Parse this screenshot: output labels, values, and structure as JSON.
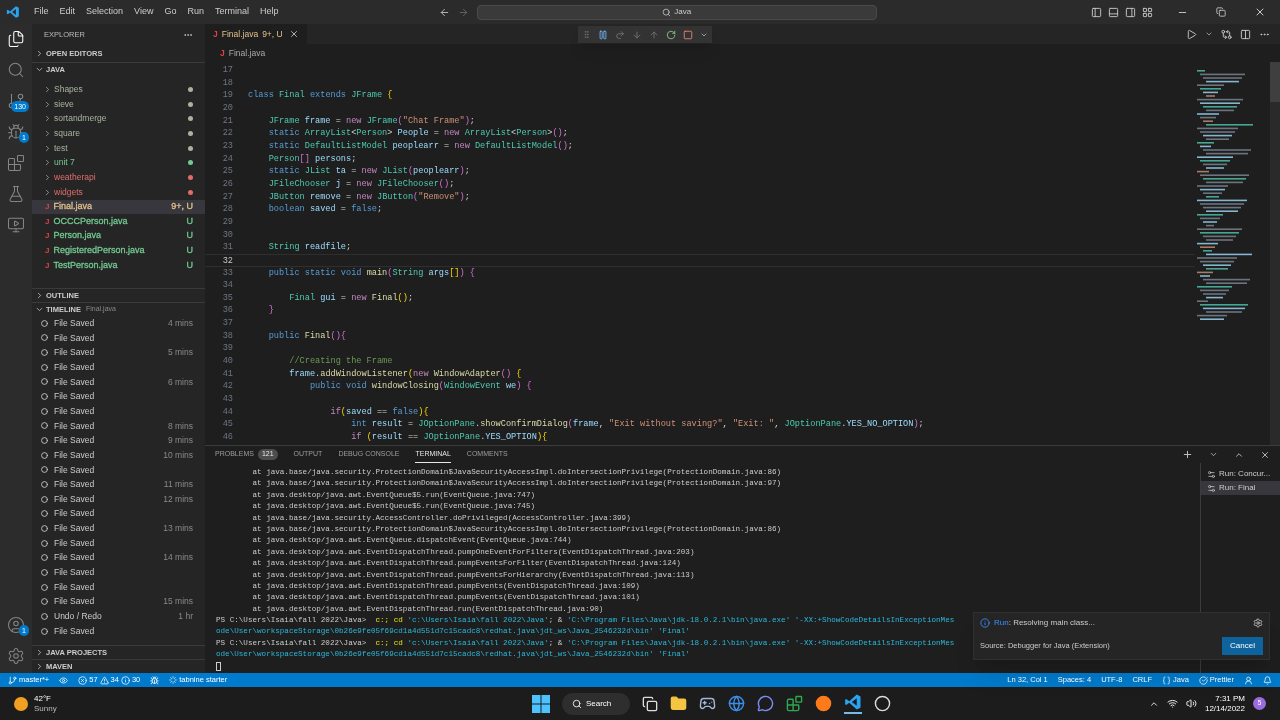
{
  "title_bar": {
    "menus": [
      "File",
      "Edit",
      "Selection",
      "View",
      "Go",
      "Run",
      "Terminal",
      "Help"
    ],
    "search": "Java"
  },
  "activity_bar": {
    "items": [
      {
        "kind": "explorer",
        "selected": true
      },
      {
        "kind": "search",
        "selected": false
      },
      {
        "kind": "scm",
        "badge": "130",
        "selected": false
      },
      {
        "kind": "debug",
        "badge": "1",
        "selected": false
      },
      {
        "kind": "extensions",
        "selected": false
      },
      {
        "kind": "testing",
        "selected": false
      },
      {
        "kind": "remote",
        "selected": false
      }
    ],
    "account_badge": "1"
  },
  "sidebar": {
    "title": "EXPLORER",
    "open_editors": "OPEN EDITORS",
    "folder": "JAVA",
    "items": [
      {
        "kind": "folder",
        "name": "Shapes",
        "color": "#a8b4a0",
        "selected": false
      },
      {
        "kind": "folder",
        "name": "sieve",
        "color": "#a8b4a0",
        "selected": false
      },
      {
        "kind": "folder",
        "name": "sortandmerge",
        "color": "#a8b4a0",
        "selected": false
      },
      {
        "kind": "folder",
        "name": "square",
        "color": "#a8b4a0",
        "selected": false
      },
      {
        "kind": "folder",
        "name": "test",
        "color": "#a8b4a0",
        "selected": false
      },
      {
        "kind": "folder",
        "name": "unit 7",
        "color": "#73c991",
        "selected": false
      },
      {
        "kind": "folder",
        "name": "weatherapi",
        "color": "#e06c6c",
        "selected": false
      },
      {
        "kind": "folder",
        "name": "widgets",
        "color": "#e06c6c",
        "selected": false
      },
      {
        "kind": "file",
        "icon": "J",
        "name": "Final.java",
        "decoration": "9+, U",
        "color": "#e2c08d",
        "selected": true
      },
      {
        "kind": "file",
        "icon": "J",
        "name": "OCCCPerson.java",
        "decoration": "U",
        "color": "#73c991",
        "selected": false
      },
      {
        "kind": "file",
        "icon": "J",
        "name": "Person.java",
        "decoration": "U",
        "color": "#73c991",
        "selected": false
      },
      {
        "kind": "file",
        "icon": "J",
        "name": "RegisteredPerson.java",
        "decoration": "U",
        "color": "#73c991",
        "selected": false
      },
      {
        "kind": "file",
        "icon": "J",
        "name": "TestPerson.java",
        "decoration": "U",
        "color": "#73c991",
        "selected": false
      }
    ],
    "outline": "OUTLINE",
    "timeline": {
      "label": "TIMELINE",
      "file": "Final.java",
      "items": [
        {
          "label": "File Saved",
          "time": "4 mins"
        },
        {
          "label": "File Saved"
        },
        {
          "label": "File Saved",
          "time": "5 mins"
        },
        {
          "label": "File Saved"
        },
        {
          "label": "File Saved",
          "time": "6 mins"
        },
        {
          "label": "File Saved"
        },
        {
          "label": "File Saved"
        },
        {
          "label": "File Saved",
          "time": "8 mins"
        },
        {
          "label": "File Saved",
          "time": "9 mins"
        },
        {
          "label": "File Saved",
          "time": "10 mins"
        },
        {
          "label": "File Saved"
        },
        {
          "label": "File Saved",
          "time": "11 mins"
        },
        {
          "label": "File Saved",
          "time": "12 mins"
        },
        {
          "label": "File Saved"
        },
        {
          "label": "File Saved",
          "time": "13 mins"
        },
        {
          "label": "File Saved"
        },
        {
          "label": "File Saved",
          "time": "14 mins"
        },
        {
          "label": "File Saved"
        },
        {
          "label": "File Saved"
        },
        {
          "label": "File Saved",
          "time": "15 mins"
        },
        {
          "label": "Undo / Redo",
          "time": "1 hr"
        },
        {
          "label": "File Saved"
        }
      ]
    },
    "bottom_sections": [
      "JAVA PROJECTS",
      "MAVEN"
    ]
  },
  "editor": {
    "tab": {
      "icon": "J",
      "label": "Final.java",
      "badge": "9+, U"
    },
    "breadcrumb": {
      "icon": "J",
      "label": "Final.java"
    },
    "lines": [
      {
        "n": "17",
        "current": false
      },
      {
        "n": "18",
        "current": false
      },
      {
        "n": "19",
        "current": false,
        "segs": [
          {
            "kind": "kw",
            "text": "class"
          },
          {
            "kind": "type",
            "text": " Final"
          },
          {
            "kind": "kw",
            "text": " extends"
          },
          {
            "kind": "type",
            "text": " JFrame"
          },
          {
            "kind": "br",
            "text": " {"
          }
        ]
      },
      {
        "n": "20",
        "current": false
      },
      {
        "n": "21",
        "current": false,
        "segs": [
          {
            "kind": "type",
            "text": "    JFrame"
          },
          {
            "kind": "var",
            "text": " frame"
          },
          {
            "kind": "pl",
            "text": " = "
          },
          {
            "kind": "ctl",
            "text": "new"
          },
          {
            "kind": "type",
            "text": " JFrame"
          },
          {
            "kind": "br2",
            "text": "("
          },
          {
            "kind": "str",
            "text": "\"Chat Frame\""
          },
          {
            "kind": "br2",
            "text": ")"
          },
          {
            "kind": "pl",
            "text": ";"
          }
        ]
      },
      {
        "n": "22",
        "current": false,
        "segs": [
          {
            "kind": "kw",
            "text": "    static"
          },
          {
            "kind": "type",
            "text": " ArrayList"
          },
          {
            "kind": "pl",
            "text": "<"
          },
          {
            "kind": "type",
            "text": "Person"
          },
          {
            "kind": "pl",
            "text": "> "
          },
          {
            "kind": "var",
            "text": "People"
          },
          {
            "kind": "pl",
            "text": " = "
          },
          {
            "kind": "ctl",
            "text": "new"
          },
          {
            "kind": "type",
            "text": " ArrayList"
          },
          {
            "kind": "pl",
            "text": "<"
          },
          {
            "kind": "type",
            "text": "Person"
          },
          {
            "kind": "pl",
            "text": ">"
          },
          {
            "kind": "br2",
            "text": "()"
          },
          {
            "kind": "pl",
            "text": ";"
          }
        ]
      },
      {
        "n": "23",
        "current": false,
        "segs": [
          {
            "kind": "kw",
            "text": "    static"
          },
          {
            "kind": "type",
            "text": " DefaultListModel"
          },
          {
            "kind": "var",
            "text": " peoplearr"
          },
          {
            "kind": "pl",
            "text": " = "
          },
          {
            "kind": "ctl",
            "text": "new"
          },
          {
            "kind": "type",
            "text": " DefaultListModel"
          },
          {
            "kind": "br2",
            "text": "()"
          },
          {
            "kind": "pl",
            "text": ";"
          }
        ]
      },
      {
        "n": "24",
        "current": false,
        "segs": [
          {
            "kind": "type",
            "text": "    Person"
          },
          {
            "kind": "br2",
            "text": "[]"
          },
          {
            "kind": "var",
            "text": " persons"
          },
          {
            "kind": "pl",
            "text": ";"
          }
        ]
      },
      {
        "n": "25",
        "current": false,
        "segs": [
          {
            "kind": "kw",
            "text": "    static"
          },
          {
            "kind": "type",
            "text": " JList"
          },
          {
            "kind": "var",
            "text": " ta"
          },
          {
            "kind": "pl",
            "text": " = "
          },
          {
            "kind": "ctl",
            "text": "new"
          },
          {
            "kind": "type",
            "text": " JList"
          },
          {
            "kind": "br2",
            "text": "("
          },
          {
            "kind": "var",
            "text": "peoplearr"
          },
          {
            "kind": "br2",
            "text": ")"
          },
          {
            "kind": "pl",
            "text": ";"
          }
        ]
      },
      {
        "n": "26",
        "current": false,
        "segs": [
          {
            "kind": "type",
            "text": "    JFileChooser"
          },
          {
            "kind": "var",
            "text": " j"
          },
          {
            "kind": "pl",
            "text": " = "
          },
          {
            "kind": "ctl",
            "text": "new"
          },
          {
            "kind": "type",
            "text": " JFileChooser"
          },
          {
            "kind": "br2",
            "text": "()"
          },
          {
            "kind": "pl",
            "text": ";"
          }
        ]
      },
      {
        "n": "27",
        "current": false,
        "segs": [
          {
            "kind": "type",
            "text": "    JButton"
          },
          {
            "kind": "var",
            "text": " remove"
          },
          {
            "kind": "pl",
            "text": " = "
          },
          {
            "kind": "ctl",
            "text": "new"
          },
          {
            "kind": "type",
            "text": " JButton"
          },
          {
            "kind": "br2",
            "text": "("
          },
          {
            "kind": "str",
            "text": "\"Remove\""
          },
          {
            "kind": "br2",
            "text": ")"
          },
          {
            "kind": "pl",
            "text": ";"
          }
        ]
      },
      {
        "n": "28",
        "current": false,
        "segs": [
          {
            "kind": "kw",
            "text": "    boolean"
          },
          {
            "kind": "var",
            "text": " saved"
          },
          {
            "kind": "pl",
            "text": " = "
          },
          {
            "kind": "kw",
            "text": "false"
          },
          {
            "kind": "pl",
            "text": ";"
          }
        ]
      },
      {
        "n": "29",
        "current": false
      },
      {
        "n": "30",
        "current": false
      },
      {
        "n": "31",
        "current": false,
        "segs": [
          {
            "kind": "type",
            "text": "    String"
          },
          {
            "kind": "var",
            "text": " readfile"
          },
          {
            "kind": "pl",
            "text": ";"
          }
        ]
      },
      {
        "n": "32",
        "current": true
      },
      {
        "n": "33",
        "current": false,
        "segs": [
          {
            "kind": "kw",
            "text": "    public static void"
          },
          {
            "kind": "fn",
            "text": " main"
          },
          {
            "kind": "br2",
            "text": "("
          },
          {
            "kind": "type",
            "text": "String"
          },
          {
            "kind": "var",
            "text": " args"
          },
          {
            "kind": "br",
            "text": "[]"
          },
          {
            "kind": "br2",
            "text": ")"
          },
          {
            "kind": "br2",
            "text": " {"
          }
        ]
      },
      {
        "n": "34",
        "current": false
      },
      {
        "n": "35",
        "current": false,
        "segs": [
          {
            "kind": "type",
            "text": "        Final"
          },
          {
            "kind": "var",
            "text": " gui"
          },
          {
            "kind": "pl",
            "text": " = "
          },
          {
            "kind": "ctl",
            "text": "new"
          },
          {
            "kind": "fn",
            "text": " Final"
          },
          {
            "kind": "br",
            "text": "()"
          },
          {
            "kind": "pl",
            "text": ";"
          }
        ]
      },
      {
        "n": "36",
        "current": false,
        "segs": [
          {
            "kind": "br2",
            "text": "    }"
          }
        ]
      },
      {
        "n": "37",
        "current": false
      },
      {
        "n": "38",
        "current": false,
        "segs": [
          {
            "kind": "kw",
            "text": "    public"
          },
          {
            "kind": "fn",
            "text": " Final"
          },
          {
            "kind": "br2",
            "text": "(){"
          }
        ]
      },
      {
        "n": "39",
        "current": false
      },
      {
        "n": "40",
        "current": false,
        "segs": [
          {
            "kind": "cmt",
            "text": "        //Creating the Frame"
          }
        ]
      },
      {
        "n": "41",
        "current": false,
        "segs": [
          {
            "kind": "var",
            "text": "        frame"
          },
          {
            "kind": "pl",
            "text": "."
          },
          {
            "kind": "fn",
            "text": "addWindowListener"
          },
          {
            "kind": "br",
            "text": "("
          },
          {
            "kind": "ctl",
            "text": "new"
          },
          {
            "kind": "fn",
            "text": " WindowAdapter"
          },
          {
            "kind": "br2",
            "text": "()"
          },
          {
            "kind": "br",
            "text": " {"
          }
        ]
      },
      {
        "n": "42",
        "current": false,
        "segs": [
          {
            "kind": "kw",
            "text": "            public void"
          },
          {
            "kind": "fn",
            "text": " windowClosing"
          },
          {
            "kind": "br2",
            "text": "("
          },
          {
            "kind": "type",
            "text": "WindowEvent"
          },
          {
            "kind": "var",
            "text": " we"
          },
          {
            "kind": "br2",
            "text": ")"
          },
          {
            "kind": "br2",
            "text": " {"
          }
        ]
      },
      {
        "n": "43",
        "current": false
      },
      {
        "n": "44",
        "current": false,
        "segs": [
          {
            "kind": "ctl",
            "text": "                if"
          },
          {
            "kind": "br",
            "text": "("
          },
          {
            "kind": "var",
            "text": "saved"
          },
          {
            "kind": "pl",
            "text": " == "
          },
          {
            "kind": "kw",
            "text": "false"
          },
          {
            "kind": "br",
            "text": "){"
          }
        ]
      },
      {
        "n": "45",
        "current": false,
        "segs": [
          {
            "kind": "kw",
            "text": "                    int"
          },
          {
            "kind": "var",
            "text": " result"
          },
          {
            "kind": "pl",
            "text": " = "
          },
          {
            "kind": "type",
            "text": "JOptionPane"
          },
          {
            "kind": "pl",
            "text": "."
          },
          {
            "kind": "fn",
            "text": "showConfirmDialog"
          },
          {
            "kind": "br2",
            "text": "("
          },
          {
            "kind": "var",
            "text": "frame"
          },
          {
            "kind": "pl",
            "text": ", "
          },
          {
            "kind": "str",
            "text": "\"Exit without saving?\""
          },
          {
            "kind": "pl",
            "text": ", "
          },
          {
            "kind": "str",
            "text": "\"Exit: \""
          },
          {
            "kind": "pl",
            "text": ", "
          },
          {
            "kind": "type",
            "text": "JOptionPane"
          },
          {
            "kind": "pl",
            "text": "."
          },
          {
            "kind": "var",
            "text": "YES_NO_OPTION"
          },
          {
            "kind": "br2",
            "text": ")"
          },
          {
            "kind": "pl",
            "text": ";"
          }
        ]
      },
      {
        "n": "46",
        "current": false,
        "segs": [
          {
            "kind": "ctl",
            "text": "                    if"
          },
          {
            "kind": "br",
            "text": " ("
          },
          {
            "kind": "var",
            "text": "result"
          },
          {
            "kind": "pl",
            "text": " == "
          },
          {
            "kind": "type",
            "text": "JOptionPane"
          },
          {
            "kind": "pl",
            "text": "."
          },
          {
            "kind": "var",
            "text": "YES_OPTION"
          },
          {
            "kind": "br",
            "text": "){"
          }
        ]
      }
    ]
  },
  "panel": {
    "tabs": [
      {
        "label": "PROBLEMS",
        "badge": "121",
        "selected": false
      },
      {
        "label": "OUTPUT",
        "selected": false
      },
      {
        "label": "DEBUG CONSOLE",
        "selected": false
      },
      {
        "label": "TERMINAL",
        "selected": true
      },
      {
        "label": "COMMENTS",
        "selected": false
      }
    ],
    "terminal_lines": [
      {
        "kind": "text",
        "segs": [
          {
            "kind": "pl",
            "text": "        at java.base/java.security.ProtectionDomain$JavaSecurityAccessImpl.doIntersectionPrivilege(ProtectionDomain.java:86)"
          }
        ]
      },
      {
        "kind": "text",
        "segs": [
          {
            "kind": "pl",
            "text": "        at java.base/java.security.ProtectionDomain$JavaSecurityAccessImpl.doIntersectionPrivilege(ProtectionDomain.java:97)"
          }
        ]
      },
      {
        "kind": "text",
        "segs": [
          {
            "kind": "pl",
            "text": "        at java.desktop/java.awt.EventQueue$5.run(EventQueue.java:747)"
          }
        ]
      },
      {
        "kind": "text",
        "segs": [
          {
            "kind": "pl",
            "text": "        at java.desktop/java.awt.EventQueue$5.run(EventQueue.java:745)"
          }
        ]
      },
      {
        "kind": "text",
        "segs": [
          {
            "kind": "pl",
            "text": "        at java.base/java.security.AccessController.doPrivileged(AccessController.java:399)"
          }
        ]
      },
      {
        "kind": "text",
        "segs": [
          {
            "kind": "pl",
            "text": "        at java.base/java.security.ProtectionDomain$JavaSecurityAccessImpl.doIntersectionPrivilege(ProtectionDomain.java:86)"
          }
        ]
      },
      {
        "kind": "text",
        "segs": [
          {
            "kind": "pl",
            "text": "        at java.desktop/java.awt.EventQueue.dispatchEvent(EventQueue.java:744)"
          }
        ]
      },
      {
        "kind": "text",
        "segs": [
          {
            "kind": "pl",
            "text": "        at java.desktop/java.awt.EventDispatchThread.pumpOneEventForFilters(EventDispatchThread.java:203)"
          }
        ]
      },
      {
        "kind": "text",
        "segs": [
          {
            "kind": "pl",
            "text": "        at java.desktop/java.awt.EventDispatchThread.pumpEventsForFilter(EventDispatchThread.java:124)"
          }
        ]
      },
      {
        "kind": "text",
        "segs": [
          {
            "kind": "pl",
            "text": "        at java.desktop/java.awt.EventDispatchThread.pumpEventsForHierarchy(EventDispatchThread.java:113)"
          }
        ]
      },
      {
        "kind": "text",
        "segs": [
          {
            "kind": "pl",
            "text": "        at java.desktop/java.awt.EventDispatchThread.pumpEvents(EventDispatchThread.java:109)"
          }
        ]
      },
      {
        "kind": "text",
        "segs": [
          {
            "kind": "pl",
            "text": "        at java.desktop/java.awt.EventDispatchThread.pumpEvents(EventDispatchThread.java:101)"
          }
        ]
      },
      {
        "kind": "text",
        "segs": [
          {
            "kind": "pl",
            "text": "        at java.desktop/java.awt.EventDispatchThread.run(EventDispatchThread.java:90)"
          }
        ]
      },
      {
        "kind": "text",
        "segs": [
          {
            "kind": "pl",
            "text": "PS C:\\Users\\Isaia\\fall 2022\\Java>"
          },
          {
            "kind": "cmd",
            "text": "  c:; cd "
          },
          {
            "kind": "str",
            "text": "'c:\\Users\\Isaia\\fall 2022\\Java'"
          },
          {
            "kind": "pl",
            "text": "; & "
          },
          {
            "kind": "str",
            "text": "'C:\\Program Files\\Java\\jdk-18.0.2.1\\bin\\java.exe' '-XX:+ShowCodeDetailsInExceptionMes"
          }
        ]
      },
      {
        "kind": "text",
        "segs": [
          {
            "kind": "str",
            "text": "ode\\User\\workspaceStorage\\0b26e9fe05f69cd1a4d551d7c15cadc8\\redhat.java\\jdt_ws\\Java_2546232d\\bin' 'Final'"
          }
        ]
      },
      {
        "kind": "text",
        "segs": [
          {
            "kind": "pl",
            "text": "PS C:\\Users\\Isaia\\fall 2022\\Java>"
          },
          {
            "kind": "cmd",
            "text": "  c:; cd "
          },
          {
            "kind": "str",
            "text": "'c:\\Users\\Isaia\\fall 2022\\Java'"
          },
          {
            "kind": "pl",
            "text": "; & "
          },
          {
            "kind": "str",
            "text": "'C:\\Program Files\\Java\\jdk-18.0.2.1\\bin\\java.exe' '-XX:+ShowCodeDetailsInExceptionMes"
          }
        ]
      },
      {
        "kind": "text",
        "segs": [
          {
            "kind": "str",
            "text": "ode\\User\\workspaceStorage\\0b26e9fe05f69cd1a4d551d7c15cadc8\\redhat.java\\jdt_ws\\Java_2546232d\\bin' 'Final'"
          }
        ]
      },
      {
        "kind": "cursor"
      }
    ],
    "terminals": [
      {
        "label": "Run: Concur...",
        "selected": false
      },
      {
        "label": "Run: Final",
        "selected": true
      }
    ],
    "notification": {
      "link": "Run",
      "message": ": Resolving main class...",
      "source": "Source: Debugger for Java (Extension)",
      "button": "Cancel"
    }
  },
  "status_bar": {
    "branch": "master*+",
    "errors": "57",
    "warnings": "34",
    "infos": "30",
    "tabnine": "tabnine starter",
    "right": [
      "Ln 32, Col 1",
      "Spaces: 4",
      "UTF-8",
      "CRLF"
    ],
    "language": "Java",
    "formatter": "Prettier"
  },
  "taskbar": {
    "temperature": "42°F",
    "condition": "Sunny",
    "search": "Search",
    "time": "7:31 PM",
    "date": "12/14/2022",
    "notification_count": "5"
  }
}
